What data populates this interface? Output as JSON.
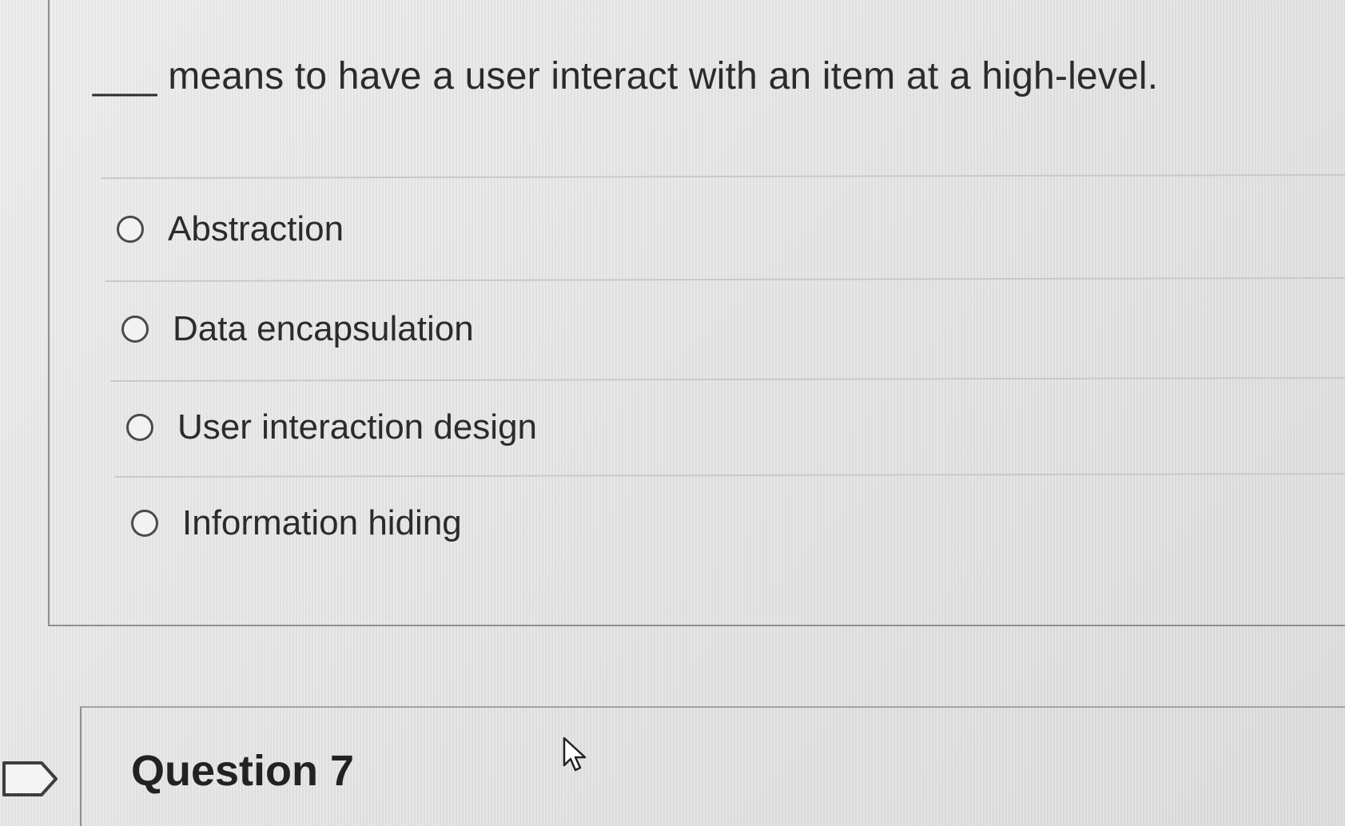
{
  "question": {
    "text": "___ means to have a user interact with an item at a high-level.",
    "options": [
      {
        "label": "Abstraction",
        "selected": false
      },
      {
        "label": "Data encapsulation",
        "selected": false
      },
      {
        "label": "User interaction design",
        "selected": false
      },
      {
        "label": "Information hiding",
        "selected": false
      }
    ]
  },
  "next_question": {
    "heading": "Question 7"
  },
  "icons": {
    "flag": "flag-icon",
    "cursor": "mouse-pointer-icon",
    "radio": "radio-button-icon"
  }
}
